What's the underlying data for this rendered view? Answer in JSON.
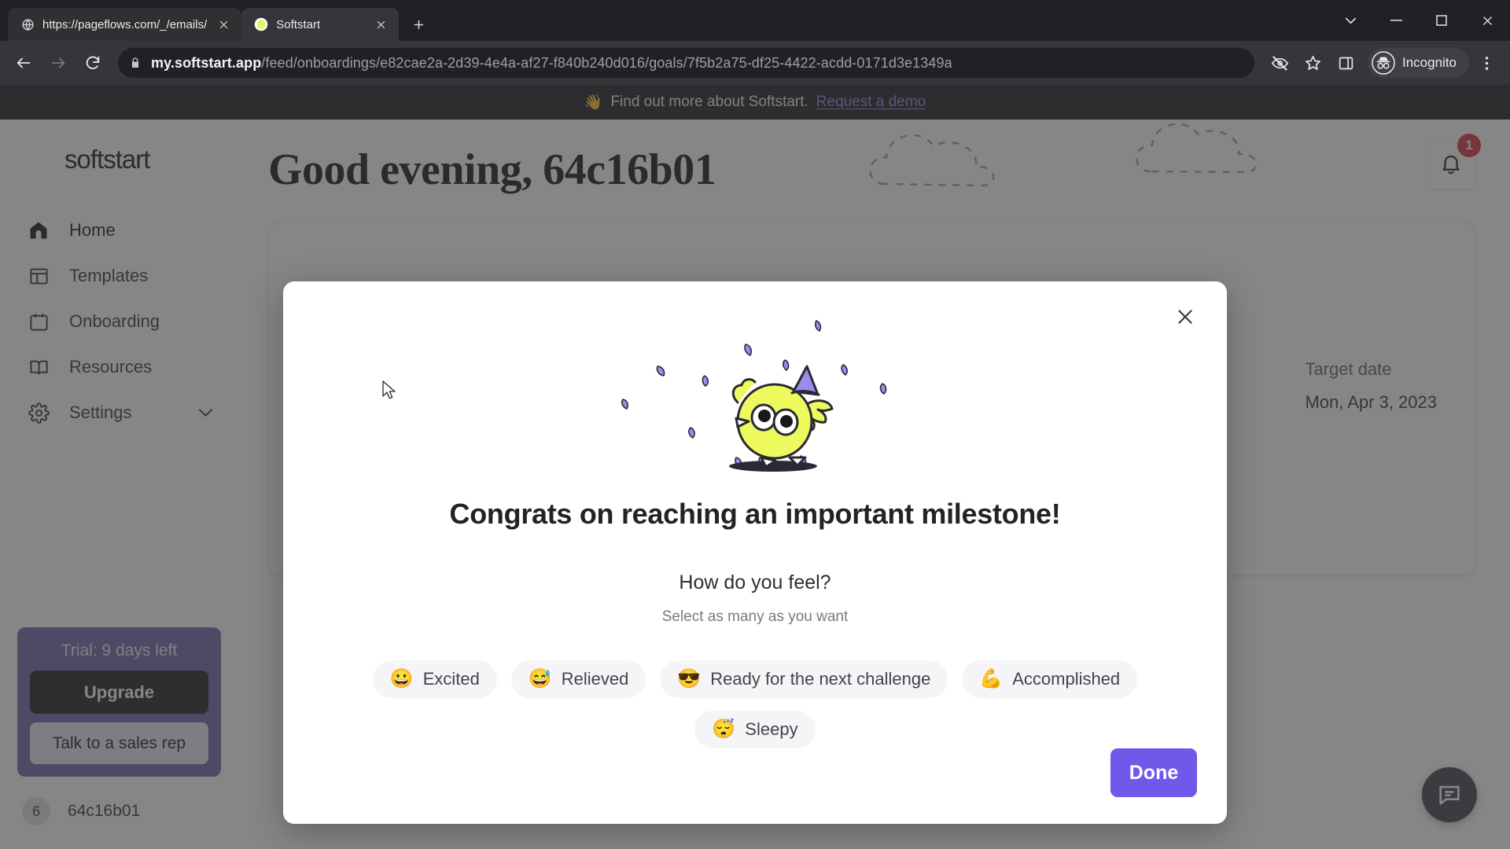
{
  "browser": {
    "tabs": [
      {
        "title": "https://pageflows.com/_/emails/",
        "favicon": "globe-icon",
        "active": false
      },
      {
        "title": "Softstart",
        "favicon": "softstart-favicon",
        "active": true
      }
    ],
    "new_tab_label": "+",
    "window_controls": {
      "minimize": "—",
      "maximize": "☐",
      "close": "✕",
      "chevron": "⌄"
    },
    "url_host": "my.softstart.app",
    "url_path": "/feed/onboardings/e82cae2a-2d39-4e4a-af27-f840b240d016/goals/7f5b2a75-df25-4422-acdd-0171d3e1349a",
    "incognito_label": "Incognito",
    "icons": {
      "back": "back-arrow-icon",
      "forward": "forward-arrow-icon",
      "reload": "reload-icon",
      "lock": "lock-icon",
      "tracking": "eye-slash-icon",
      "bookmark": "star-icon",
      "side_panel": "side-panel-icon",
      "incognito": "incognito-avatar-icon",
      "menu": "three-dot-menu-icon"
    }
  },
  "banner": {
    "emoji": "👋",
    "text": "Find out more about Softstart.",
    "link": "Request a demo"
  },
  "sidebar": {
    "brand": "softstart",
    "items": [
      {
        "label": "Home",
        "icon": "home-icon",
        "active": true
      },
      {
        "label": "Templates",
        "icon": "templates-icon",
        "active": false
      },
      {
        "label": "Onboarding",
        "icon": "calendar-icon",
        "active": false
      },
      {
        "label": "Resources",
        "icon": "book-icon",
        "active": false
      },
      {
        "label": "Settings",
        "icon": "gear-icon",
        "active": false,
        "chevron": "chevron-down-icon"
      }
    ],
    "trial": {
      "title": "Trial: 9 days left",
      "upgrade_label": "Upgrade",
      "sales_label": "Talk to a sales rep",
      "bg_color": "#6f5fa8"
    },
    "user": {
      "avatar_initial": "6",
      "name": "64c16b01"
    }
  },
  "main": {
    "greeting": "Good evening, 64c16b01",
    "meta_label": "Target date",
    "meta_value": "Mon, Apr 3, 2023",
    "notification_count": "1",
    "bell_icon": "bell-icon",
    "chat_icon": "chat-bubble-icon"
  },
  "modal": {
    "close_icon": "close-icon",
    "illustration": "celebrating-bird-with-party-hat",
    "title": "Congrats on reaching an important milestone!",
    "question": "How do you feel?",
    "hint": "Select as many as you want",
    "chips": [
      {
        "emoji": "😀",
        "label": "Excited"
      },
      {
        "emoji": "😅",
        "label": "Relieved"
      },
      {
        "emoji": "😎",
        "label": "Ready for the next challenge"
      },
      {
        "emoji": "💪",
        "label": "Accomplished"
      },
      {
        "emoji": "😴",
        "label": "Sleepy"
      }
    ],
    "done_label": "Done",
    "accent_color": "#7059ea"
  }
}
